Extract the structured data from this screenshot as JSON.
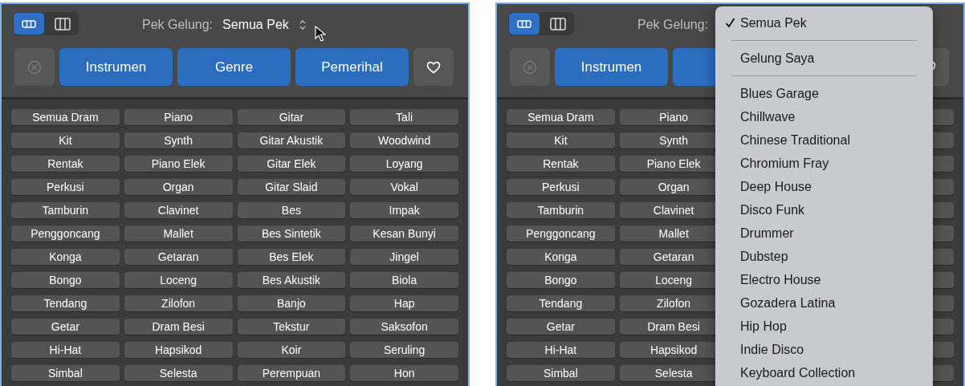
{
  "panels": [
    {
      "view_toggle": [
        {
          "selected": true
        },
        {
          "selected": false
        }
      ],
      "loop_pack_label": "Pek Gelung:",
      "loop_pack_value": "Semua Pek",
      "filter_buttons": [
        "Instrumen",
        "Genre",
        "Pemerihal"
      ],
      "grid": [
        [
          "Semua Dram",
          "Piano",
          "Gitar",
          "Tali"
        ],
        [
          "Kit",
          "Synth",
          "Gitar Akustik",
          "Woodwind"
        ],
        [
          "Rentak",
          "Piano Elek",
          "Gitar Elek",
          "Loyang"
        ],
        [
          "Perkusi",
          "Organ",
          "Gitar Slaid",
          "Vokal"
        ],
        [
          "Tamburin",
          "Clavinet",
          "Bes",
          "Impak"
        ],
        [
          "Penggoncang",
          "Mallet",
          "Bes Sintetik",
          "Kesan Bunyi"
        ],
        [
          "Konga",
          "Getaran",
          "Bes Elek",
          "Jingel"
        ],
        [
          "Bongo",
          "Loceng",
          "Bes Akustik",
          "Biola"
        ],
        [
          "Tendang",
          "Zilofon",
          "Banjo",
          "Hap"
        ],
        [
          "Getar",
          "Dram Besi",
          "Tekstur",
          "Saksofon"
        ],
        [
          "Hi-Hat",
          "Hapsikod",
          "Koir",
          "Seruling"
        ],
        [
          "Simbal",
          "Selesta",
          "Perempuan",
          "Hon"
        ]
      ]
    },
    {
      "view_toggle": [
        {
          "selected": true
        },
        {
          "selected": false
        }
      ],
      "loop_pack_label": "Pek Gelung:",
      "filter_buttons": [
        "Instrumen"
      ],
      "grid": [
        [
          "Semua Dram",
          "Piano"
        ],
        [
          "Kit",
          "Synth"
        ],
        [
          "Rentak",
          "Piano Elek"
        ],
        [
          "Perkusi",
          "Organ"
        ],
        [
          "Tamburin",
          "Clavinet"
        ],
        [
          "Penggoncang",
          "Mallet"
        ],
        [
          "Konga",
          "Getaran"
        ],
        [
          "Bongo",
          "Loceng"
        ],
        [
          "Tendang",
          "Zilofon"
        ],
        [
          "Getar",
          "Dram Besi"
        ],
        [
          "Hi-Hat",
          "Hapsikod"
        ],
        [
          "Simbal",
          "Selesta"
        ]
      ],
      "menu": {
        "sections": [
          [
            {
              "label": "Semua Pek",
              "checked": true
            }
          ],
          [
            {
              "label": "Gelung Saya",
              "checked": false
            }
          ],
          [
            {
              "label": "Blues Garage",
              "checked": false
            },
            {
              "label": "Chillwave",
              "checked": false
            },
            {
              "label": "Chinese Traditional",
              "checked": false
            },
            {
              "label": "Chromium Fray",
              "checked": false
            },
            {
              "label": "Deep House",
              "checked": false
            },
            {
              "label": "Disco Funk",
              "checked": false
            },
            {
              "label": "Drummer",
              "checked": false
            },
            {
              "label": "Dubstep",
              "checked": false
            },
            {
              "label": "Electro House",
              "checked": false
            },
            {
              "label": "Gozadera Latina",
              "checked": false
            },
            {
              "label": "Hip Hop",
              "checked": false
            },
            {
              "label": "Indie Disco",
              "checked": false
            },
            {
              "label": "Keyboard Collection",
              "checked": false
            }
          ]
        ]
      }
    }
  ]
}
